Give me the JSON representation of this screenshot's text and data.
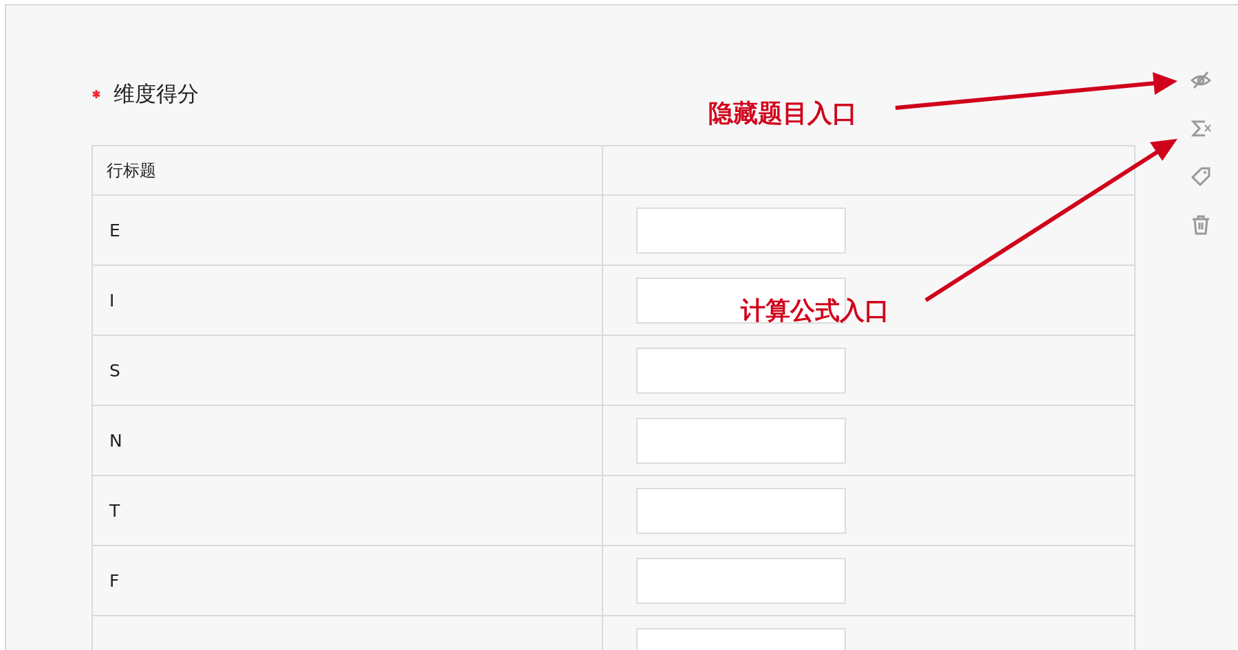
{
  "question": {
    "title": "维度得分",
    "required": true
  },
  "table": {
    "columns": [
      "行标题"
    ],
    "rows": [
      {
        "kind": "row",
        "label": "E"
      },
      {
        "kind": "row",
        "label": "I"
      },
      {
        "kind": "row",
        "label": "S"
      },
      {
        "kind": "row",
        "label": "N"
      },
      {
        "kind": "row",
        "label": "T"
      },
      {
        "kind": "row",
        "label": "F"
      },
      {
        "kind": "cut"
      }
    ]
  },
  "annotations": [
    {
      "text": "隐藏题目入口"
    },
    {
      "text": "计算公式入口"
    }
  ]
}
